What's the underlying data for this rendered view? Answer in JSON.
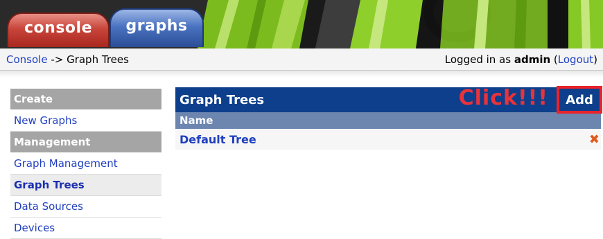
{
  "tabs": [
    {
      "label": "console"
    },
    {
      "label": "graphs"
    }
  ],
  "breadcrumb": {
    "console_link": "Console",
    "separator": " -> ",
    "current": "Graph Trees"
  },
  "login": {
    "prefix": "Logged in as ",
    "user": "admin",
    "open_paren": " (",
    "logout_label": "Logout",
    "close_paren": ")"
  },
  "sidebar": {
    "items": [
      {
        "label": "Create",
        "kind": "header"
      },
      {
        "label": "New Graphs",
        "kind": "link"
      },
      {
        "label": "Management",
        "kind": "header"
      },
      {
        "label": "Graph Management",
        "kind": "link"
      },
      {
        "label": "Graph Trees",
        "kind": "active"
      },
      {
        "label": "Data Sources",
        "kind": "link"
      },
      {
        "label": "Devices",
        "kind": "link"
      }
    ]
  },
  "main": {
    "title": "Graph Trees",
    "annotation": "Click!!!",
    "add_label": "Add",
    "column_header": "Name",
    "rows": [
      {
        "name": "Default Tree",
        "delete_icon": "delete-x-icon"
      }
    ]
  },
  "colors": {
    "title_bar": "#0d3f8c",
    "column_header": "#6c86b0",
    "link": "#1f3fbf",
    "annotation": "#e8333a",
    "sidebar_header": "#a5a5a5"
  }
}
